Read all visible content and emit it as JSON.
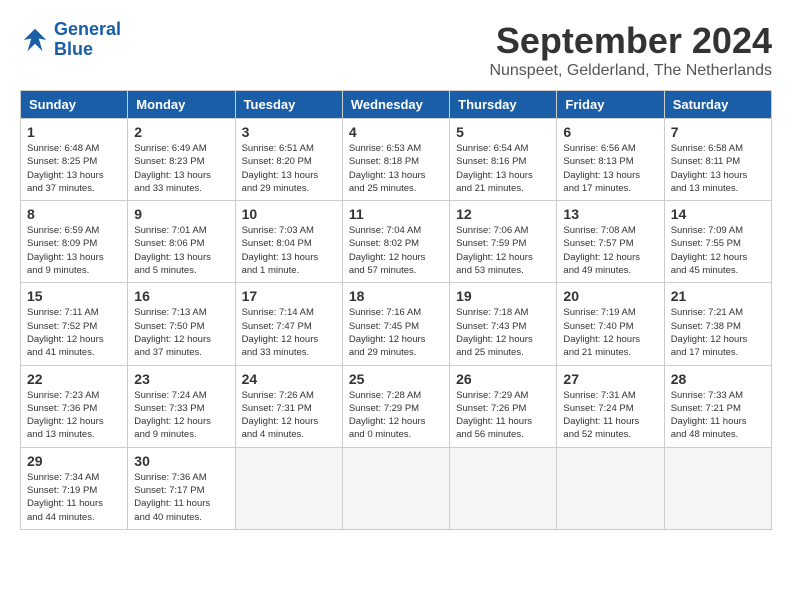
{
  "logo": {
    "line1": "General",
    "line2": "Blue"
  },
  "title": "September 2024",
  "subtitle": "Nunspeet, Gelderland, The Netherlands",
  "weekdays": [
    "Sunday",
    "Monday",
    "Tuesday",
    "Wednesday",
    "Thursday",
    "Friday",
    "Saturday"
  ],
  "weeks": [
    [
      {
        "day": "1",
        "info": "Sunrise: 6:48 AM\nSunset: 8:25 PM\nDaylight: 13 hours\nand 37 minutes."
      },
      {
        "day": "2",
        "info": "Sunrise: 6:49 AM\nSunset: 8:23 PM\nDaylight: 13 hours\nand 33 minutes."
      },
      {
        "day": "3",
        "info": "Sunrise: 6:51 AM\nSunset: 8:20 PM\nDaylight: 13 hours\nand 29 minutes."
      },
      {
        "day": "4",
        "info": "Sunrise: 6:53 AM\nSunset: 8:18 PM\nDaylight: 13 hours\nand 25 minutes."
      },
      {
        "day": "5",
        "info": "Sunrise: 6:54 AM\nSunset: 8:16 PM\nDaylight: 13 hours\nand 21 minutes."
      },
      {
        "day": "6",
        "info": "Sunrise: 6:56 AM\nSunset: 8:13 PM\nDaylight: 13 hours\nand 17 minutes."
      },
      {
        "day": "7",
        "info": "Sunrise: 6:58 AM\nSunset: 8:11 PM\nDaylight: 13 hours\nand 13 minutes."
      }
    ],
    [
      {
        "day": "8",
        "info": "Sunrise: 6:59 AM\nSunset: 8:09 PM\nDaylight: 13 hours\nand 9 minutes."
      },
      {
        "day": "9",
        "info": "Sunrise: 7:01 AM\nSunset: 8:06 PM\nDaylight: 13 hours\nand 5 minutes."
      },
      {
        "day": "10",
        "info": "Sunrise: 7:03 AM\nSunset: 8:04 PM\nDaylight: 13 hours\nand 1 minute."
      },
      {
        "day": "11",
        "info": "Sunrise: 7:04 AM\nSunset: 8:02 PM\nDaylight: 12 hours\nand 57 minutes."
      },
      {
        "day": "12",
        "info": "Sunrise: 7:06 AM\nSunset: 7:59 PM\nDaylight: 12 hours\nand 53 minutes."
      },
      {
        "day": "13",
        "info": "Sunrise: 7:08 AM\nSunset: 7:57 PM\nDaylight: 12 hours\nand 49 minutes."
      },
      {
        "day": "14",
        "info": "Sunrise: 7:09 AM\nSunset: 7:55 PM\nDaylight: 12 hours\nand 45 minutes."
      }
    ],
    [
      {
        "day": "15",
        "info": "Sunrise: 7:11 AM\nSunset: 7:52 PM\nDaylight: 12 hours\nand 41 minutes."
      },
      {
        "day": "16",
        "info": "Sunrise: 7:13 AM\nSunset: 7:50 PM\nDaylight: 12 hours\nand 37 minutes."
      },
      {
        "day": "17",
        "info": "Sunrise: 7:14 AM\nSunset: 7:47 PM\nDaylight: 12 hours\nand 33 minutes."
      },
      {
        "day": "18",
        "info": "Sunrise: 7:16 AM\nSunset: 7:45 PM\nDaylight: 12 hours\nand 29 minutes."
      },
      {
        "day": "19",
        "info": "Sunrise: 7:18 AM\nSunset: 7:43 PM\nDaylight: 12 hours\nand 25 minutes."
      },
      {
        "day": "20",
        "info": "Sunrise: 7:19 AM\nSunset: 7:40 PM\nDaylight: 12 hours\nand 21 minutes."
      },
      {
        "day": "21",
        "info": "Sunrise: 7:21 AM\nSunset: 7:38 PM\nDaylight: 12 hours\nand 17 minutes."
      }
    ],
    [
      {
        "day": "22",
        "info": "Sunrise: 7:23 AM\nSunset: 7:36 PM\nDaylight: 12 hours\nand 13 minutes."
      },
      {
        "day": "23",
        "info": "Sunrise: 7:24 AM\nSunset: 7:33 PM\nDaylight: 12 hours\nand 9 minutes."
      },
      {
        "day": "24",
        "info": "Sunrise: 7:26 AM\nSunset: 7:31 PM\nDaylight: 12 hours\nand 4 minutes."
      },
      {
        "day": "25",
        "info": "Sunrise: 7:28 AM\nSunset: 7:29 PM\nDaylight: 12 hours\nand 0 minutes."
      },
      {
        "day": "26",
        "info": "Sunrise: 7:29 AM\nSunset: 7:26 PM\nDaylight: 11 hours\nand 56 minutes."
      },
      {
        "day": "27",
        "info": "Sunrise: 7:31 AM\nSunset: 7:24 PM\nDaylight: 11 hours\nand 52 minutes."
      },
      {
        "day": "28",
        "info": "Sunrise: 7:33 AM\nSunset: 7:21 PM\nDaylight: 11 hours\nand 48 minutes."
      }
    ],
    [
      {
        "day": "29",
        "info": "Sunrise: 7:34 AM\nSunset: 7:19 PM\nDaylight: 11 hours\nand 44 minutes."
      },
      {
        "day": "30",
        "info": "Sunrise: 7:36 AM\nSunset: 7:17 PM\nDaylight: 11 hours\nand 40 minutes."
      },
      {
        "day": "",
        "info": ""
      },
      {
        "day": "",
        "info": ""
      },
      {
        "day": "",
        "info": ""
      },
      {
        "day": "",
        "info": ""
      },
      {
        "day": "",
        "info": ""
      }
    ]
  ]
}
